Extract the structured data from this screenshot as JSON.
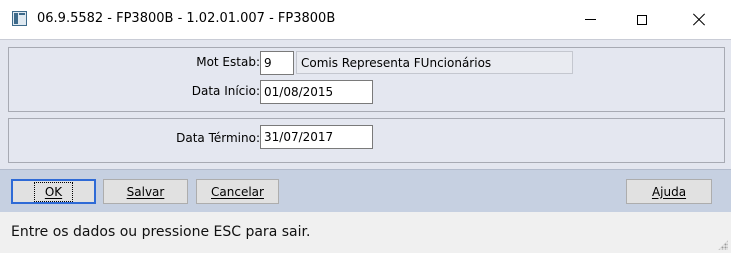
{
  "window": {
    "title": "06.9.5582 - FP3800B - 1.02.01.007 - FP3800B",
    "controls": {
      "minimize": "minimize-icon",
      "maximize": "maximize-icon",
      "close": "close-icon"
    }
  },
  "form": {
    "mot_estab": {
      "label": "Mot Estab:",
      "code": "9",
      "description": "Comis Representa FUncionários"
    },
    "data_inicio": {
      "label": "Data Início:",
      "value": "01/08/2015"
    },
    "data_termino": {
      "label": "Data Término:",
      "value": "31/07/2017"
    }
  },
  "buttons": {
    "ok": "OK",
    "salvar": "Salvar",
    "cancelar": "Cancelar",
    "ajuda": "Ajuda"
  },
  "status": {
    "message": "Entre os dados ou pressione ESC para sair."
  }
}
